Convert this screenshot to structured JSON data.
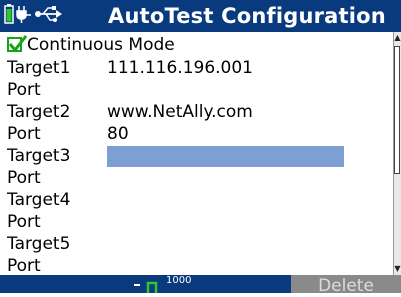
{
  "title": "AutoTest Configuration",
  "continuous_mode": {
    "label": "Continuous Mode",
    "checked": true
  },
  "rows": [
    {
      "label": "Target1",
      "value": "111.116.196.001"
    },
    {
      "label": "Port",
      "value": ""
    },
    {
      "label": "Target2",
      "value": "www.NetAlly.com"
    },
    {
      "label": "Port",
      "value": "80"
    },
    {
      "label": "Target3",
      "value": ""
    },
    {
      "label": "Port",
      "value": ""
    },
    {
      "label": "Target4",
      "value": ""
    },
    {
      "label": "Port",
      "value": ""
    },
    {
      "label": "Target5",
      "value": ""
    },
    {
      "label": "Port",
      "value": ""
    }
  ],
  "status": {
    "speed": "1000"
  },
  "softkey": {
    "delete_label": "Delete"
  },
  "colors": {
    "titlebar": "#0a3a7e",
    "selected_field": "#7e9fd4",
    "check": "#17a317",
    "disabled_key": "#8a8a8a"
  },
  "icons": [
    "battery-icon",
    "power-plug-icon",
    "usb-icon",
    "check-icon",
    "link-indicator-icon"
  ]
}
